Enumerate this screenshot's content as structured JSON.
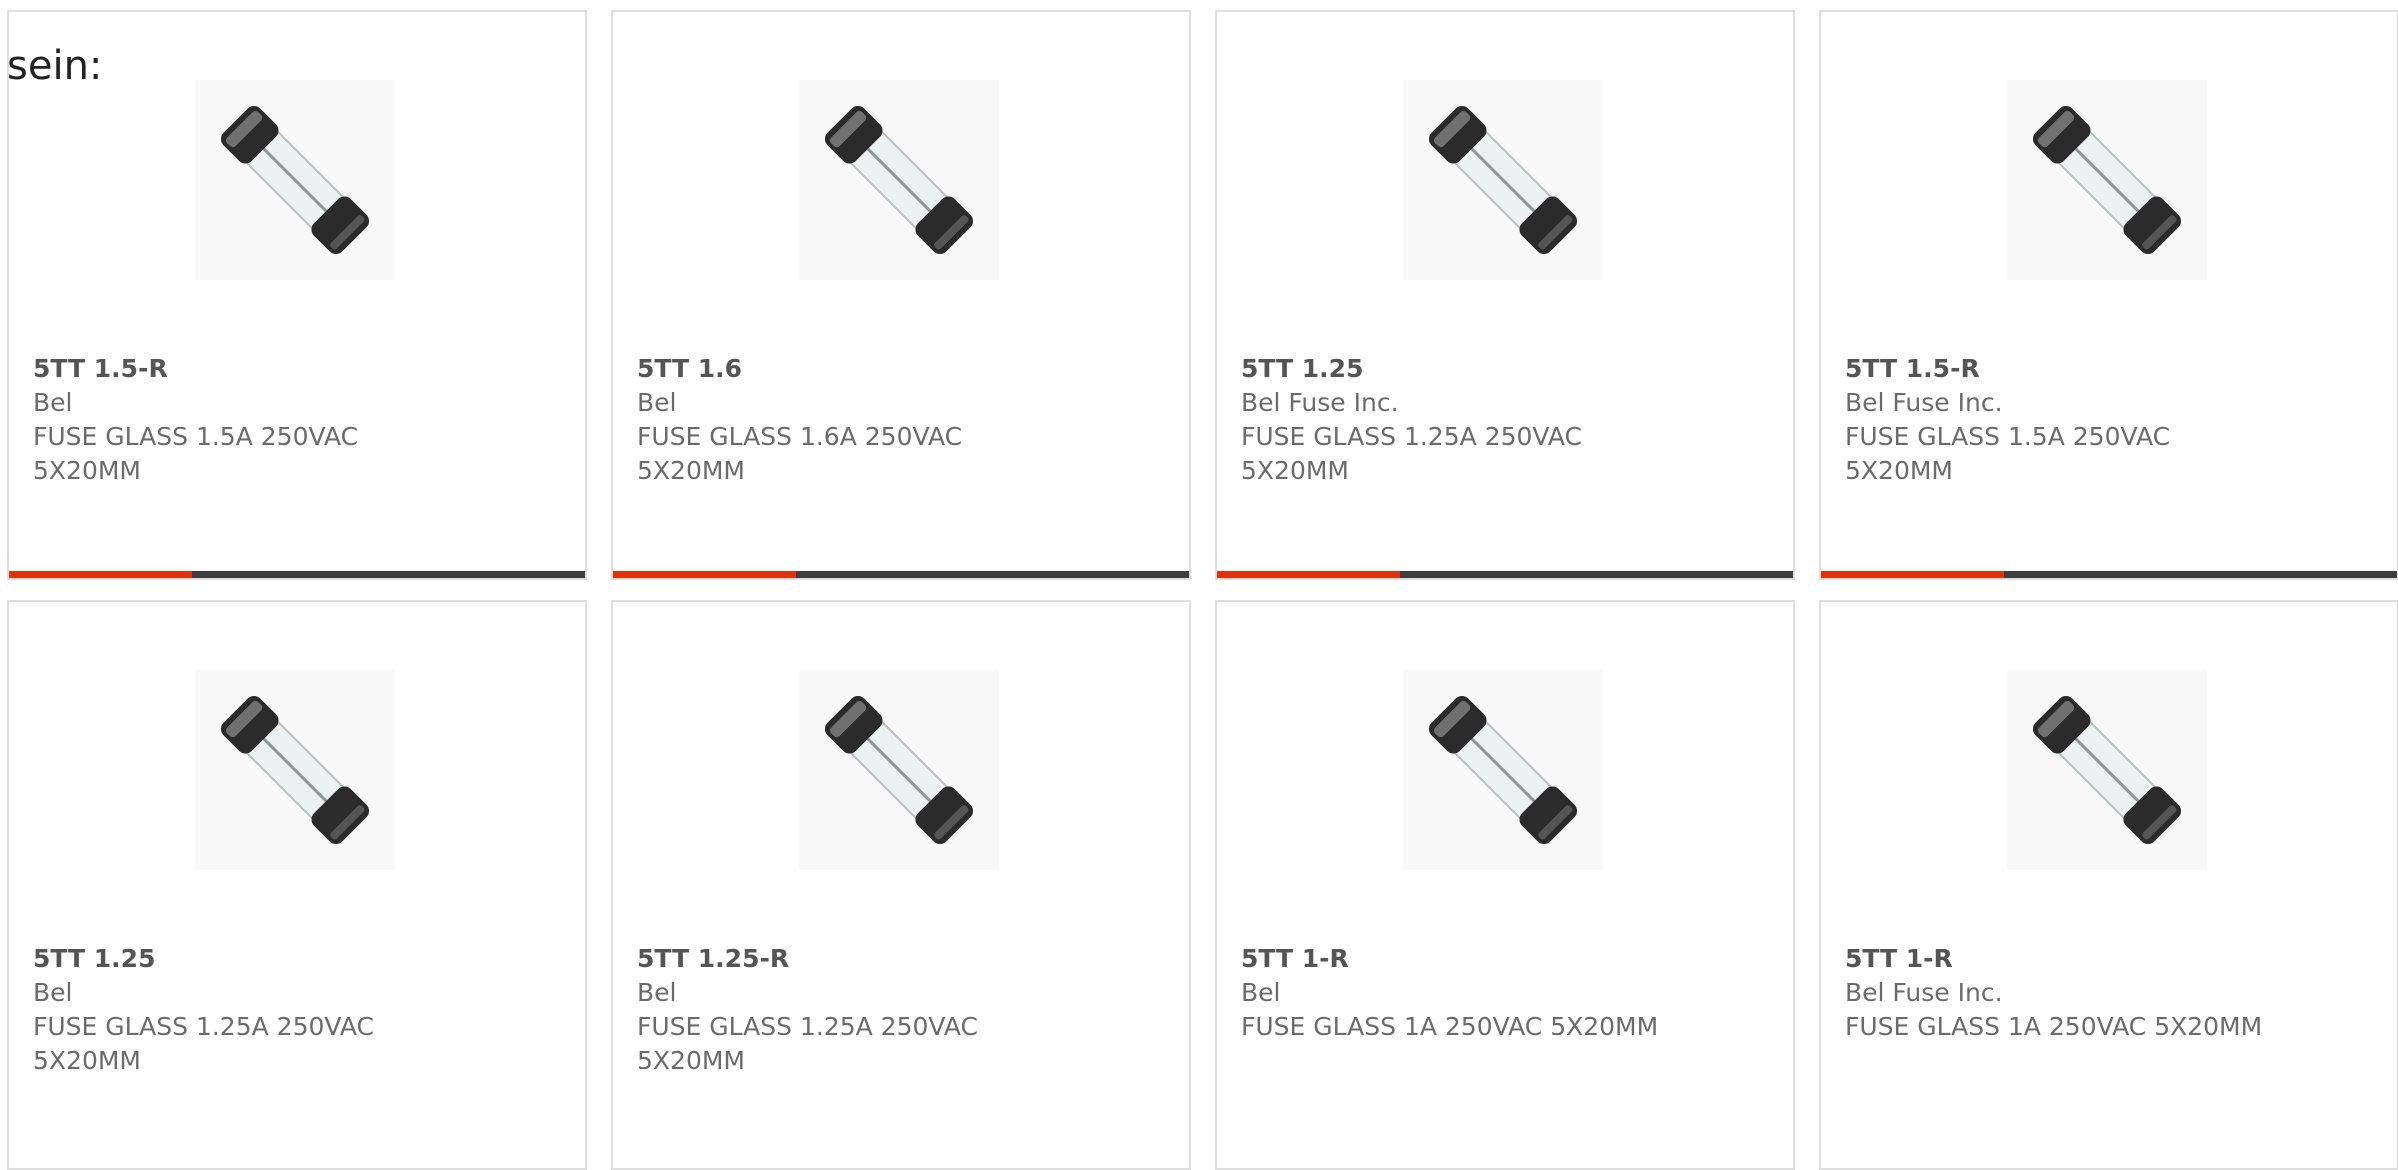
{
  "intro_text": "sein:",
  "products": [
    {
      "part": "5TT 1.5-R",
      "maker": "Bel",
      "desc": "FUSE GLASS 1.5A 250VAC 5X20MM",
      "icon": "glass-fuse-icon"
    },
    {
      "part": "5TT 1.6",
      "maker": "Bel",
      "desc": "FUSE GLASS 1.6A 250VAC 5X20MM",
      "icon": "glass-fuse-icon"
    },
    {
      "part": "5TT 1.25",
      "maker": "Bel Fuse Inc.",
      "desc": "FUSE GLASS 1.25A 250VAC 5X20MM",
      "icon": "glass-fuse-icon"
    },
    {
      "part": "5TT 1.5-R",
      "maker": "Bel Fuse Inc.",
      "desc": "FUSE GLASS 1.5A 250VAC 5X20MM",
      "icon": "glass-fuse-icon"
    },
    {
      "part": "5TT 1.25",
      "maker": "Bel",
      "desc": "FUSE GLASS 1.25A 250VAC 5X20MM",
      "icon": "glass-fuse-icon"
    },
    {
      "part": "5TT 1.25-R",
      "maker": "Bel",
      "desc": "FUSE GLASS 1.25A 250VAC 5X20MM",
      "icon": "glass-fuse-icon"
    },
    {
      "part": "5TT 1-R",
      "maker": "Bel",
      "desc": "FUSE GLASS 1A 250VAC 5X20MM",
      "icon": "glass-fuse-icon"
    },
    {
      "part": "5TT 1-R",
      "maker": "Bel Fuse Inc.",
      "desc": "FUSE GLASS 1A 250VAC 5X20MM",
      "icon": "glass-fuse-icon"
    }
  ],
  "colors": {
    "accent": "#e0330c",
    "bar_dark": "#3f3f3f",
    "card_border": "#dedede",
    "text": "#6b6b6b"
  }
}
